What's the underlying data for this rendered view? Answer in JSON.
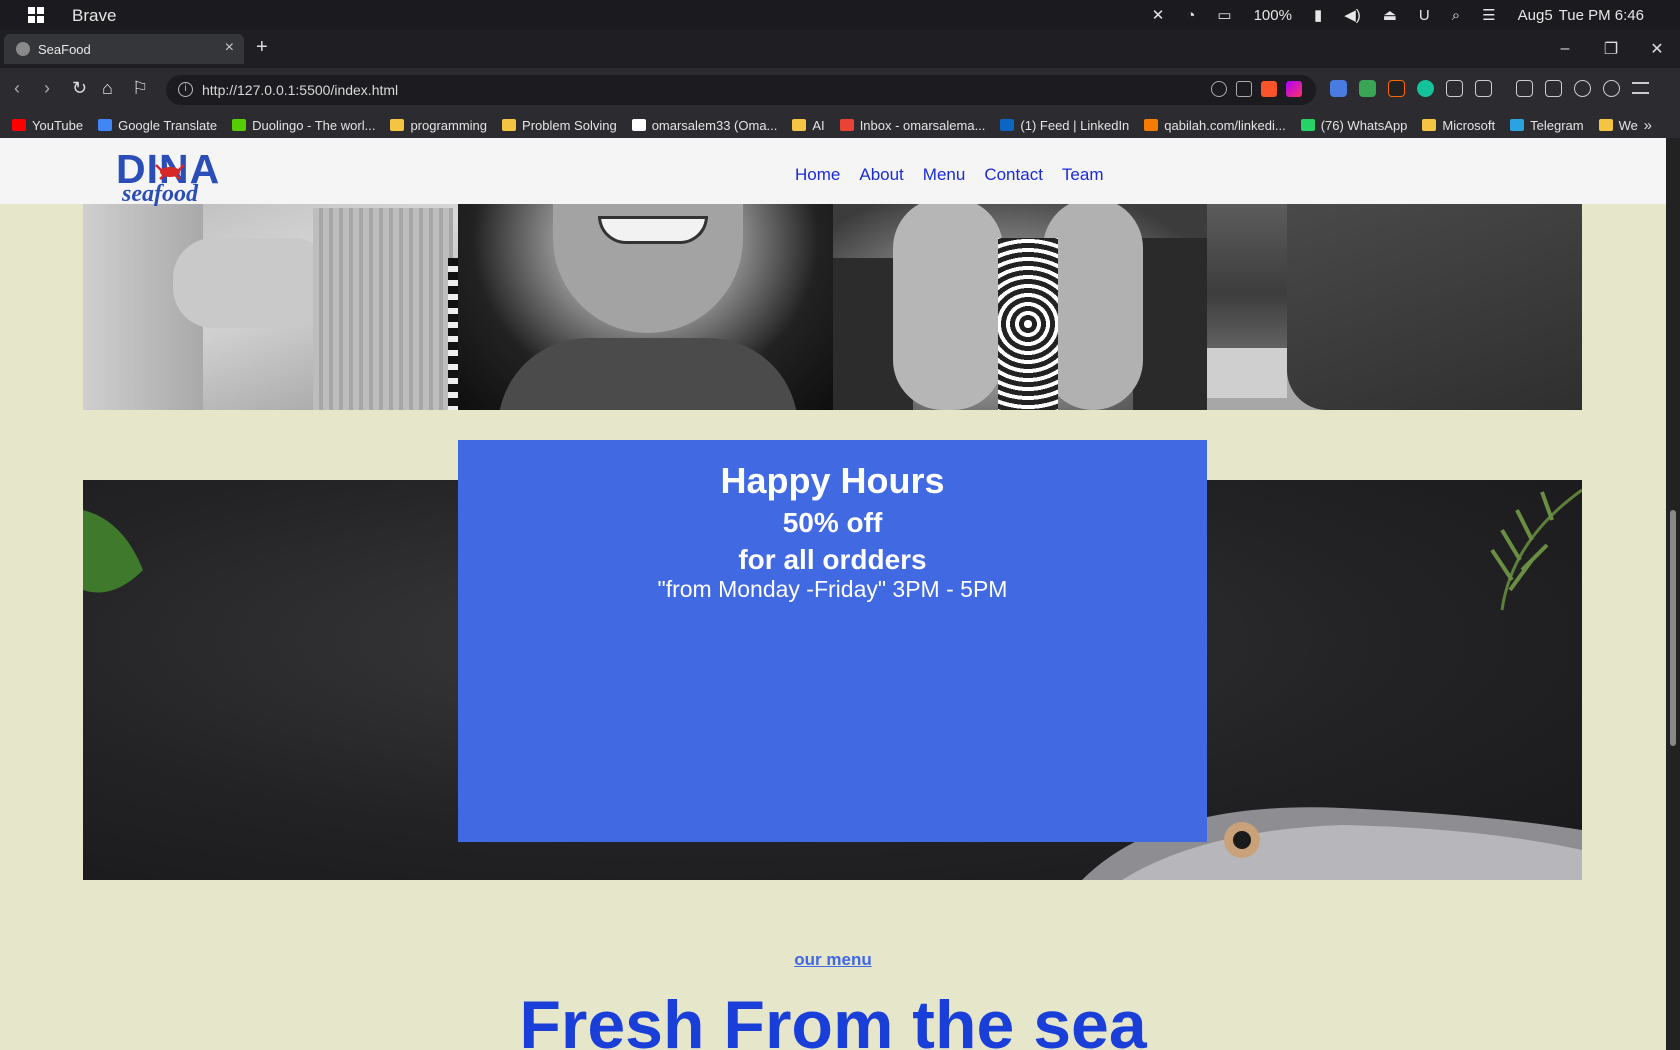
{
  "os": {
    "app_name": "Brave",
    "battery": "100%",
    "date": "Aug5",
    "day_time": "Tue PM 6:46"
  },
  "browser": {
    "tab_title": "SeaFood",
    "url": "http://127.0.0.1:5500/index.html",
    "bookmarks": [
      {
        "label": "YouTube",
        "color": "#ff0000"
      },
      {
        "label": "Google Translate",
        "color": "#4285f4"
      },
      {
        "label": "Duolingo - The worl...",
        "color": "#58cc02"
      },
      {
        "label": "programming",
        "color": "#f4c542"
      },
      {
        "label": "Problem Solving",
        "color": "#f4c542"
      },
      {
        "label": "omarsalem33 (Oma...",
        "color": "#ffffff"
      },
      {
        "label": "AI",
        "color": "#f4c542"
      },
      {
        "label": "Inbox - omarsalema...",
        "color": "#ea4335"
      },
      {
        "label": "(1) Feed | LinkedIn",
        "color": "#0a66c2"
      },
      {
        "label": "qabilah.com/linkedi...",
        "color": "#f57c00"
      },
      {
        "label": "(76) WhatsApp",
        "color": "#25d366"
      },
      {
        "label": "Microsoft",
        "color": "#f4c542"
      },
      {
        "label": "Telegram",
        "color": "#2aa3e0"
      },
      {
        "label": "We",
        "color": "#f4c542"
      }
    ]
  },
  "site": {
    "logo_main": "DINA",
    "logo_sub": "seafood",
    "nav": [
      "Home",
      "About",
      "Menu",
      "Contact",
      "Team"
    ],
    "happy_hours": {
      "title": "Happy Hours",
      "line1": "50% off",
      "line2": "for all ordders",
      "line3": "\"from Monday -Friday\" 3PM - 5PM"
    },
    "menu_link": "our menu",
    "menu_title": "Fresh From the sea"
  },
  "colors": {
    "accent_blue": "#4169e1",
    "nav_blue": "#1a2bd6",
    "page_bg": "#e6e6cb"
  }
}
